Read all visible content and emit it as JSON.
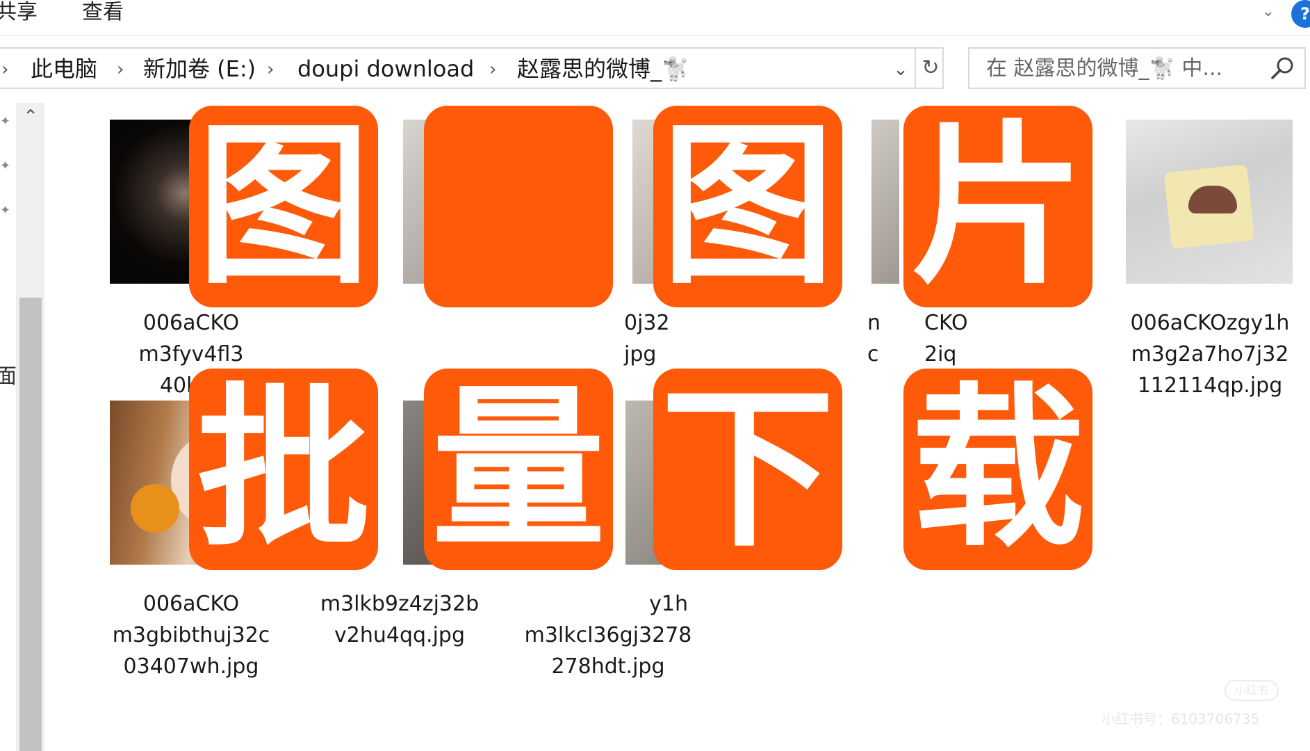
{
  "ribbon": {
    "tabs": [
      "共享",
      "查看"
    ]
  },
  "address": {
    "crumbs": [
      "此电脑",
      "新加卷 (E:)",
      "doupi download",
      "赵露思的微博_🐩"
    ]
  },
  "search": {
    "placeholder": "在 赵露思的微博_🐩 中..."
  },
  "nav": {
    "label": "面"
  },
  "files": [
    {
      "lines": [
        "006aCKO",
        "m3fyv4fl3",
        "40kjl.j"
      ]
    },
    {
      "lines": [
        "",
        "",
        ""
      ]
    },
    {
      "lines": [
        "",
        "0j32",
        "jpg"
      ]
    },
    {
      "lines": [
        "n",
        "c",
        ""
      ]
    },
    {
      "lines": [
        "CKO",
        "2iq",
        ""
      ]
    },
    {
      "lines": [
        "006aCKOzgy1h",
        "m3g2a7ho7j32",
        "112114qp.jpg"
      ]
    },
    {
      "lines": [
        "006aCKO",
        "m3gbibthuj32c",
        "03407wh.jpg"
      ]
    },
    {
      "lines": [
        "",
        "m3lkb9z4zj32b",
        "v2hu4qq.jpg"
      ]
    },
    {
      "lines": [
        "y1h",
        "m3lkcl36gj3278",
        "278hdt.jpg"
      ]
    }
  ],
  "banner": {
    "chars": [
      "图",
      "片",
      "批",
      "量",
      "下",
      "载"
    ],
    "color": "#ff5a0a"
  },
  "watermark": {
    "logo": "小红书",
    "text": "小红书号：6103706735"
  }
}
